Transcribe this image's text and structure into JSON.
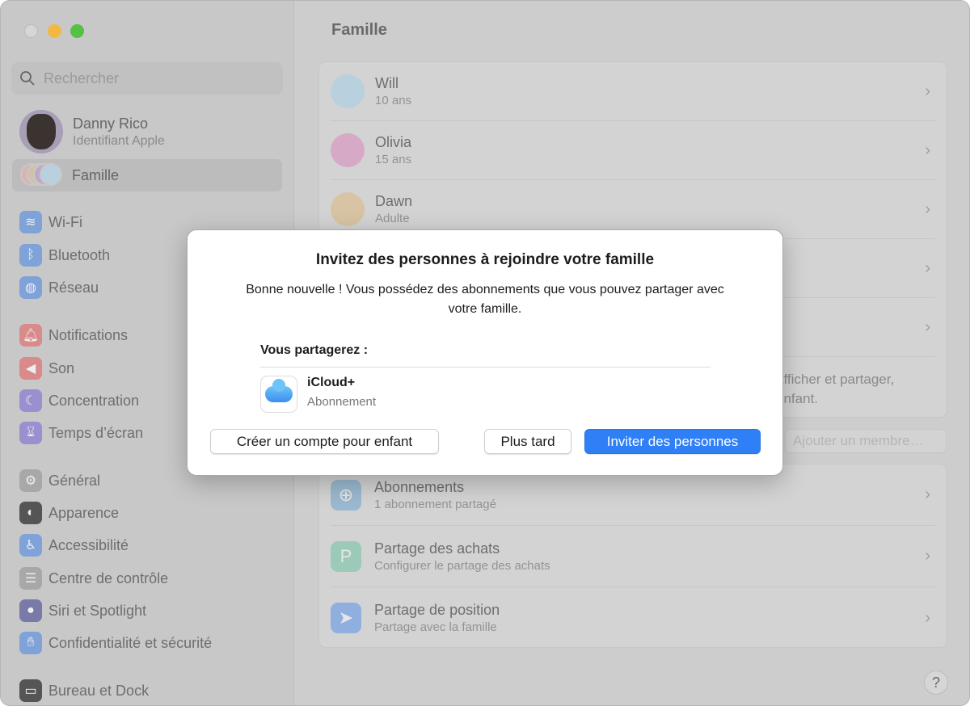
{
  "window": {
    "title": "Famille"
  },
  "sidebar": {
    "search_placeholder": "Rechercher",
    "account": {
      "name": "Danny Rico",
      "subtitle": "Identifiant Apple"
    },
    "family_label": "Famille",
    "items": [
      {
        "label": "Wi-Fi",
        "icon": "wifi-icon",
        "color": "#7fa3d9"
      },
      {
        "label": "Bluetooth",
        "icon": "bluetooth-icon",
        "color": "#7fa3d9"
      },
      {
        "label": "Réseau",
        "icon": "globe-icon",
        "color": "#7fa3d9"
      },
      {
        "label": "Notifications",
        "icon": "bell-icon",
        "color": "#d98a8a"
      },
      {
        "label": "Son",
        "icon": "speaker-icon",
        "color": "#d98a8a"
      },
      {
        "label": "Concentration",
        "icon": "moon-icon",
        "color": "#9b8fcf"
      },
      {
        "label": "Temps d’écran",
        "icon": "hourglass-icon",
        "color": "#9b8fcf"
      },
      {
        "label": "Général",
        "icon": "gear-icon",
        "color": "#a8a8a8"
      },
      {
        "label": "Apparence",
        "icon": "appearance-icon",
        "color": "#555555"
      },
      {
        "label": "Accessibilité",
        "icon": "accessibility-icon",
        "color": "#7fa3d9"
      },
      {
        "label": "Centre de contrôle",
        "icon": "switches-icon",
        "color": "#a8a8a8"
      },
      {
        "label": "Siri et Spotlight",
        "icon": "siri-icon",
        "color": "#7a7aa8"
      },
      {
        "label": "Confidentialité et sécurité",
        "icon": "hand-icon",
        "color": "#7fa3d9"
      },
      {
        "label": "Bureau et Dock",
        "icon": "dock-icon",
        "color": "#555555"
      }
    ]
  },
  "members": [
    {
      "name": "Will",
      "detail": "10 ans",
      "color": "#b9d0de"
    },
    {
      "name": "Olivia",
      "detail": "15 ans",
      "color": "#d6a9c6"
    },
    {
      "name": "Dawn",
      "detail": "Adulte",
      "color": "#d8c4a4"
    }
  ],
  "family_note": "afficher et partager, enfant.",
  "family_note_lines": [
    "afficher et partager,",
    "enfant."
  ],
  "add_member": "Ajouter un membre…",
  "services": [
    {
      "name": "Abonnements",
      "detail": "1 abonnement partagé",
      "icon": "subscriptions-icon",
      "color": "#9ab8cf"
    },
    {
      "name": "Partage des achats",
      "detail": "Configurer le partage des achats",
      "icon": "purchase-sharing-icon",
      "color": "#9ccab8"
    },
    {
      "name": "Partage de position",
      "detail": "Partage avec la famille",
      "icon": "location-icon",
      "color": "#8fb0de"
    }
  ],
  "help_label": "?",
  "dialog": {
    "title": "Invitez des personnes à rejoindre votre famille",
    "body": "Bonne nouvelle ! Vous possédez des abonnements que vous pouvez partager avec votre famille.",
    "share_heading": "Vous partagerez :",
    "item": {
      "name": "iCloud+",
      "detail": "Abonnement"
    },
    "buttons": {
      "child": "Créer un compte pour enfant",
      "later": "Plus tard",
      "invite": "Inviter des personnes"
    },
    "accent": "#2f7ff7"
  }
}
